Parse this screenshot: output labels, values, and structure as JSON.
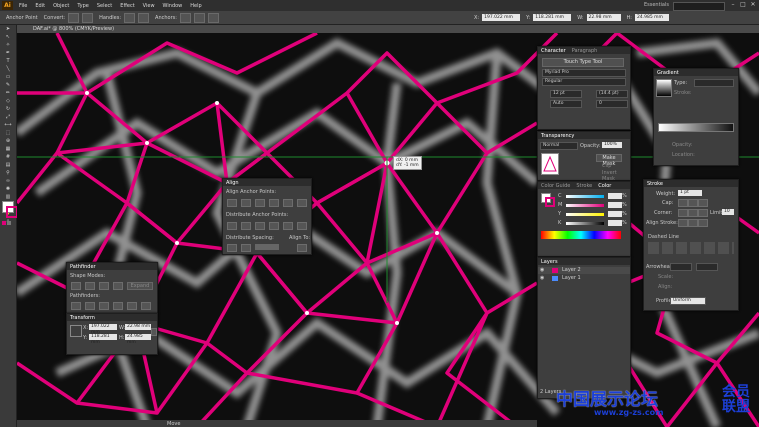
{
  "app": {
    "logo": "Ai",
    "workspace": "Essentials"
  },
  "menu": [
    "File",
    "Edit",
    "Object",
    "Type",
    "Select",
    "Effect",
    "View",
    "Window",
    "Help"
  ],
  "control_bar": {
    "selection_label": "Anchor Point",
    "convert_label": "Convert:",
    "handles_label": "Handles:",
    "anchors_label": "Anchors:",
    "x_value": "197.022 mm",
    "y_value": "118.281 mm",
    "w_value": "22.98 mm",
    "h_value": "24.985 mm"
  },
  "document": {
    "tab_title": "DAF.ai* @ 800% (CMYK/Preview)",
    "tooltip_dx": "dX: 0 mm",
    "tooltip_dy": "dY: -1 mm"
  },
  "character_panel": {
    "tabs": [
      "Character",
      "Paragraph"
    ],
    "touch_type": "Touch Type Tool",
    "font": "Myriad Pro",
    "style": "Regular",
    "size": "12 pt",
    "leading": "(14.4 pt)",
    "kerning": "Auto",
    "tracking": "0"
  },
  "transparency_panel": {
    "title": "Transparency",
    "blend_mode": "Normal",
    "opacity_label": "Opacity:",
    "opacity": "100%",
    "make_mask": "Make Mask",
    "clip": "Clip",
    "invert": "Invert Mask"
  },
  "color_panel": {
    "tabs": [
      "Color Guide",
      "Stroke",
      "Color"
    ],
    "channels": [
      "C",
      "M",
      "Y",
      "K"
    ],
    "unit": "%"
  },
  "layers_panel": {
    "title": "Layers",
    "layers": [
      "Layer 2",
      "Layer 1"
    ],
    "footer": "2 Layers"
  },
  "gradient_panel": {
    "title": "Gradient",
    "type_label": "Type:",
    "stroke_label": "Stroke:",
    "opacity_label": "Opacity:",
    "location_label": "Location:"
  },
  "stroke_panel": {
    "title": "Stroke",
    "weight_label": "Weight:",
    "weight": "1 pt",
    "cap_label": "Cap:",
    "corner_label": "Corner:",
    "limit_label": "Limit:",
    "limit": "10",
    "align_label": "Align Stroke:",
    "dashed_label": "Dashed Line",
    "arrowheads_label": "Arrowheads:",
    "scale_label": "Scale:",
    "align2_label": "Align:",
    "profile_label": "Profile:",
    "profile": "Uniform"
  },
  "align_panel": {
    "title": "Align",
    "align_anchor": "Align Anchor Points:",
    "distribute_anchor": "Distribute Anchor Points:",
    "distribute_spacing": "Distribute Spacing:",
    "align_to": "Align To:"
  },
  "pathfinder_panel": {
    "title": "Pathfinder",
    "shape_modes": "Shape Modes:",
    "pathfinders": "Pathfinders:",
    "expand": "Expand"
  },
  "transform_panel": {
    "title": "Transform",
    "x": "197.022 mm",
    "y": "118.281 mm",
    "w": "22.98 mm",
    "h": "24.985 mm"
  },
  "status": {
    "tool": "Move"
  },
  "watermark": {
    "text": "中国展示论坛",
    "url": "www.zg-zs.com",
    "side": "会员 联盟"
  },
  "colors": {
    "accent": "#e0007a",
    "canvas": "#0e0e0e",
    "panel": "#3e3e3e"
  }
}
